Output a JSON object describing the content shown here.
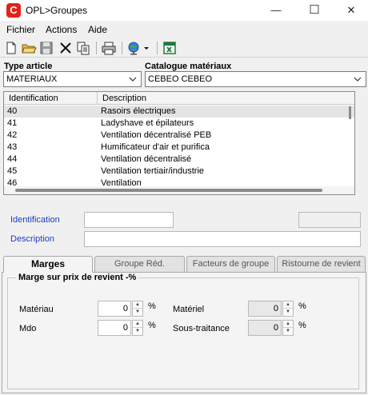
{
  "window": {
    "title": "OPL>Groupes",
    "app_icon_letter": "C",
    "minimize": "—",
    "maximize": "☐",
    "close": "✕"
  },
  "menu": [
    "Fichier",
    "Actions",
    "Aide"
  ],
  "toolbar": {
    "icons": [
      "new-icon",
      "open-icon",
      "save-icon",
      "delete-icon",
      "copy-icon",
      "print-icon",
      "globe-icon",
      "excel-icon"
    ],
    "accent_green": "#1d7a3a"
  },
  "type_article": {
    "label": "Type article",
    "value": "MATERIAUX"
  },
  "catalogue": {
    "label": "Catalogue matériaux",
    "value": "CEBEO  CEBEO"
  },
  "grid": {
    "columns": [
      "Identification",
      "Description"
    ],
    "rows": [
      [
        "40",
        "Rasoirs électriques"
      ],
      [
        "41",
        "Ladyshave et épilateurs"
      ],
      [
        "42",
        "Ventilation décentralisé PEB"
      ],
      [
        "43",
        "Humificateur d'air et purifica"
      ],
      [
        "44",
        "Ventilation décentralisé"
      ],
      [
        "45",
        "Ventilation tertiair/industrie"
      ],
      [
        "46",
        "Ventilation"
      ]
    ],
    "selected_index": 0
  },
  "detail": {
    "identification_label": "Identification",
    "description_label": "Description",
    "identification_value": "",
    "description_value": ""
  },
  "tabs": [
    "Marges",
    "Groupe Réd.",
    "Facteurs de groupe",
    "Ristourne de revient"
  ],
  "active_tab": 0,
  "marges": {
    "group_title": "Marge sur prix de revient -%",
    "materiau_label": "Matériau",
    "materiau_value": "0",
    "mdo_label": "Mdo",
    "mdo_value": "0",
    "materiel_label": "Matériel",
    "materiel_value": "0",
    "sous_traitance_label": "Sous-traitance",
    "sous_traitance_value": "0",
    "percent": "%"
  }
}
